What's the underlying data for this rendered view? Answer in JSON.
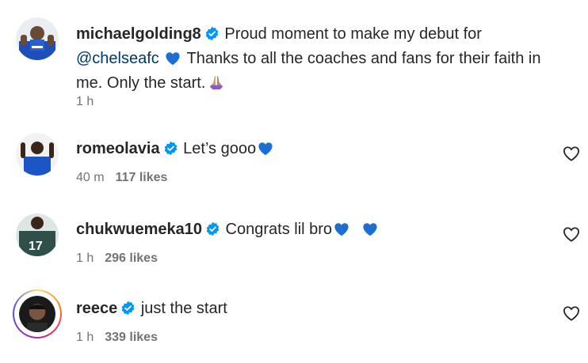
{
  "post": {
    "username": "michaelgolding8",
    "caption_part1": "Proud moment to make my debut for",
    "mention": "@chelseafc",
    "caption_part2": "Thanks to all the coaches and fans for their faith in me. Only the start.",
    "time": "1 h"
  },
  "comments": [
    {
      "username": "romeolavia",
      "text": "Let’s gooo",
      "time": "40 m",
      "likes": "117 likes"
    },
    {
      "username": "chukwuemeka10",
      "text": "Congrats lil bro",
      "time": "1 h",
      "likes": "296 likes"
    },
    {
      "username": "reece",
      "text": "just the start",
      "time": "1 h",
      "likes": "339 likes"
    }
  ],
  "colors": {
    "verified": "#0095f6",
    "blue_heart": "#1c6fd1",
    "secondary_text": "#737373"
  },
  "icons": {
    "verified": "verified-badge-icon",
    "blue_heart": "blue-heart-emoji",
    "pray": "folded-hands-emoji",
    "like": "heart-outline-icon"
  }
}
